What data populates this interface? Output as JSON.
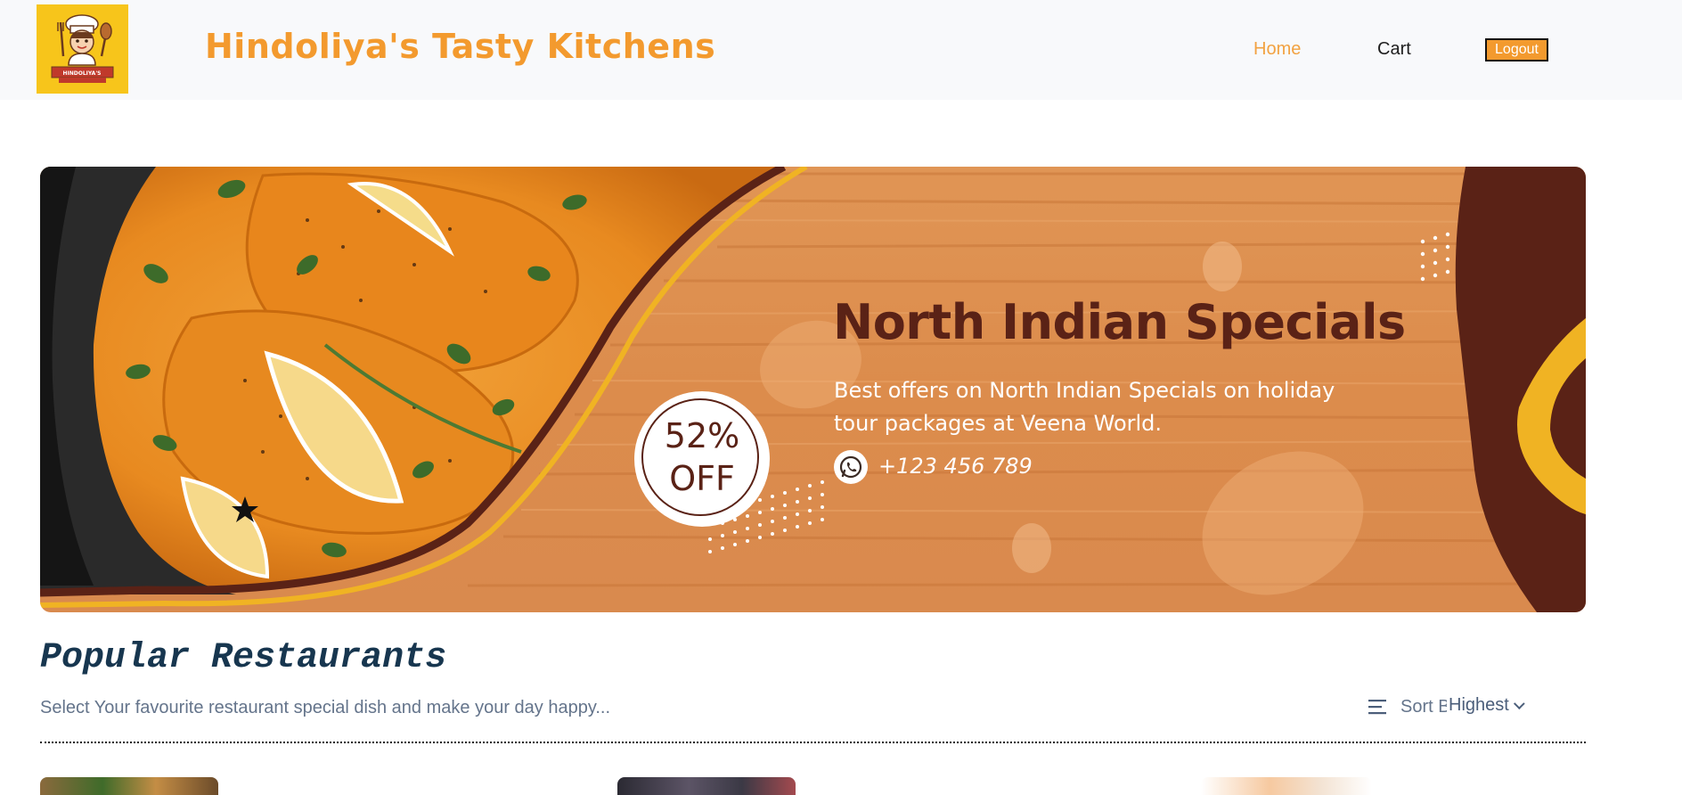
{
  "header": {
    "brand": "Hindoliya's Tasty Kitchens",
    "logo_text": "HINDOLIYA'S",
    "nav": {
      "home_label": "Home",
      "cart_label": "Cart"
    },
    "logout_label": "Logout"
  },
  "banner": {
    "title": "North Indian Specials",
    "description": "Best offers on North Indian Specials on holiday tour packages at Veena World.",
    "phone": "+123 456 789",
    "discount_percent": "52%",
    "discount_off": "OFF"
  },
  "section": {
    "title": "Popular Restaurants",
    "subtitle": "Select Your favourite restaurant special dish and make your day happy...",
    "sort": {
      "label": "Sort By",
      "selected": "Highest"
    }
  },
  "colors": {
    "brand_orange": "#f39a2e",
    "nav_active": "#f2a241",
    "logo_bg": "#f7c51b",
    "banner_wood": "#df8f52",
    "banner_brown": "#5a2216",
    "banner_gold": "#f0b323",
    "section_title": "#17364f",
    "muted_text": "#64748b"
  },
  "icons": {
    "logo": "chef-logo-icon",
    "whatsapp": "whatsapp-icon",
    "sort": "sort-lines-icon",
    "chevron": "chevron-down-icon"
  }
}
